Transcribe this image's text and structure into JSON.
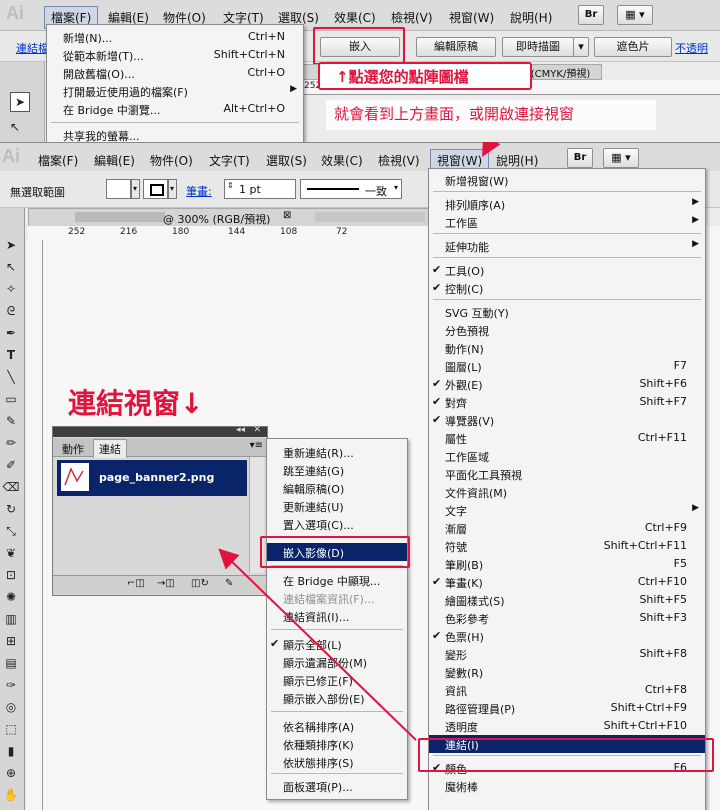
{
  "top": {
    "app_logo": "Ai",
    "menus": [
      "檔案(F)",
      "編輯(E)",
      "物件(O)",
      "文字(T)",
      "選取(S)",
      "效果(C)",
      "檢視(V)",
      "視窗(W)",
      "說明(H)"
    ],
    "br_label": "Br",
    "link_label": "連結檔",
    "buttons": {
      "embed": "嵌入",
      "edit_original": "編輯原稿",
      "live_trace": "即時描圖",
      "mask": "遮色片",
      "opacity": "不透明"
    },
    "doc_tab_suffix": "150% (CMYK/預視)",
    "ruler_label": "252",
    "file_menu": [
      {
        "label": "新增(N)...",
        "shortcut": "Ctrl+N"
      },
      {
        "label": "從範本新增(T)...",
        "shortcut": "Shift+Ctrl+N"
      },
      {
        "label": "開啟舊檔(O)...",
        "shortcut": "Ctrl+O"
      },
      {
        "label": "打開最近使用過的檔案(F)",
        "shortcut": ""
      },
      {
        "label": "在 Bridge 中瀏覽...",
        "shortcut": "Alt+Ctrl+O"
      },
      {
        "label": "共享我的螢幕...",
        "shortcut": ""
      }
    ]
  },
  "annotations": {
    "click_tip": "↑點選您的點陣圖檔",
    "window_tip": "就會看到上方畫面，或開啟連接視窗",
    "links_window": "連結視窗↓"
  },
  "bottom": {
    "app_logo": "Ai",
    "menus": [
      "檔案(F)",
      "編輯(E)",
      "物件(O)",
      "文字(T)",
      "選取(S)",
      "效果(C)",
      "檢視(V)",
      "視窗(W)",
      "說明(H)"
    ],
    "br_label": "Br",
    "control": {
      "no_selection": "無選取範圍",
      "stroke_label": "筆畫:",
      "stroke_value": "1 pt",
      "stroke_style": "一致"
    },
    "doc_tab_title": "@ 300% (RGB/預視)",
    "ruler_h": [
      "252",
      "216",
      "180",
      "144",
      "108",
      "72"
    ],
    "links_panel": {
      "tab_actions": "動作",
      "tab_links": "連結",
      "file_name": "page_banner2.png"
    },
    "context_menu": [
      {
        "label": "重新連結(R)...",
        "state": "normal"
      },
      {
        "label": "跳至連結(G)",
        "state": "normal"
      },
      {
        "label": "編輯原稿(O)",
        "state": "normal"
      },
      {
        "label": "更新連結(U)",
        "state": "normal"
      },
      {
        "label": "置入選項(C)...",
        "state": "normal"
      },
      {
        "label": "嵌入影像(D)",
        "state": "highlight"
      },
      {
        "label": "在 Bridge 中顯現...",
        "state": "normal"
      },
      {
        "label": "連結檔案資訊(F)...",
        "state": "disabled"
      },
      {
        "label": "連結資訊(I)...",
        "state": "normal"
      },
      {
        "label": "顯示全部(L)",
        "state": "checked"
      },
      {
        "label": "顯示遺漏部份(M)",
        "state": "normal"
      },
      {
        "label": "顯示已修正(F)",
        "state": "normal"
      },
      {
        "label": "顯示嵌入部份(E)",
        "state": "normal"
      },
      {
        "label": "依名稱排序(A)",
        "state": "normal"
      },
      {
        "label": "依種類排序(K)",
        "state": "normal"
      },
      {
        "label": "依狀態排序(S)",
        "state": "normal"
      },
      {
        "label": "面板選項(P)...",
        "state": "normal"
      }
    ],
    "view_menu": [
      {
        "label": "新增視窗(W)",
        "shortcut": "",
        "check": false,
        "sub": false
      },
      {
        "label": "排列順序(A)",
        "shortcut": "",
        "check": false,
        "sub": true
      },
      {
        "label": "工作區",
        "shortcut": "",
        "check": false,
        "sub": true
      },
      {
        "label": "延伸功能",
        "shortcut": "",
        "check": false,
        "sub": true
      },
      {
        "label": "工具(O)",
        "shortcut": "",
        "check": true,
        "sub": false
      },
      {
        "label": "控制(C)",
        "shortcut": "",
        "check": true,
        "sub": false
      },
      {
        "label": "SVG 互動(Y)",
        "shortcut": "",
        "check": false,
        "sub": false
      },
      {
        "label": "分色預視",
        "shortcut": "",
        "check": false,
        "sub": false
      },
      {
        "label": "動作(N)",
        "shortcut": "",
        "check": false,
        "sub": false
      },
      {
        "label": "圖層(L)",
        "shortcut": "F7",
        "check": false,
        "sub": false
      },
      {
        "label": "外觀(E)",
        "shortcut": "Shift+F6",
        "check": true,
        "sub": false
      },
      {
        "label": "對齊",
        "shortcut": "Shift+F7",
        "check": true,
        "sub": false
      },
      {
        "label": "導覽器(V)",
        "shortcut": "",
        "check": true,
        "sub": false
      },
      {
        "label": "屬性",
        "shortcut": "Ctrl+F11",
        "check": false,
        "sub": false
      },
      {
        "label": "工作區域",
        "shortcut": "",
        "check": false,
        "sub": false
      },
      {
        "label": "平面化工具預視",
        "shortcut": "",
        "check": false,
        "sub": false
      },
      {
        "label": "文件資訊(M)",
        "shortcut": "",
        "check": false,
        "sub": false
      },
      {
        "label": "文字",
        "shortcut": "",
        "check": false,
        "sub": true
      },
      {
        "label": "漸層",
        "shortcut": "Ctrl+F9",
        "check": false,
        "sub": false
      },
      {
        "label": "符號",
        "shortcut": "Shift+Ctrl+F11",
        "check": false,
        "sub": false
      },
      {
        "label": "筆刷(B)",
        "shortcut": "F5",
        "check": false,
        "sub": false
      },
      {
        "label": "筆畫(K)",
        "shortcut": "Ctrl+F10",
        "check": true,
        "sub": false
      },
      {
        "label": "繪圖樣式(S)",
        "shortcut": "Shift+F5",
        "check": false,
        "sub": false
      },
      {
        "label": "色彩參考",
        "shortcut": "Shift+F3",
        "check": false,
        "sub": false
      },
      {
        "label": "色票(H)",
        "shortcut": "",
        "check": true,
        "sub": false
      },
      {
        "label": "變形",
        "shortcut": "Shift+F8",
        "check": false,
        "sub": false
      },
      {
        "label": "變數(R)",
        "shortcut": "",
        "check": false,
        "sub": false
      },
      {
        "label": "資訊",
        "shortcut": "Ctrl+F8",
        "check": false,
        "sub": false
      },
      {
        "label": "路徑管理員(P)",
        "shortcut": "Shift+Ctrl+F9",
        "check": false,
        "sub": false
      },
      {
        "label": "透明度",
        "shortcut": "Shift+Ctrl+F10",
        "check": false,
        "sub": false
      },
      {
        "label": "連結(I)",
        "shortcut": "",
        "check": false,
        "sub": false
      },
      {
        "label": "顏色",
        "shortcut": "F6",
        "check": true,
        "sub": false
      },
      {
        "label": "魔術棒",
        "shortcut": "",
        "check": false,
        "sub": false
      }
    ]
  },
  "colors": {
    "annotation_red": "#e0143c",
    "menu_highlight": "#0a246a"
  }
}
